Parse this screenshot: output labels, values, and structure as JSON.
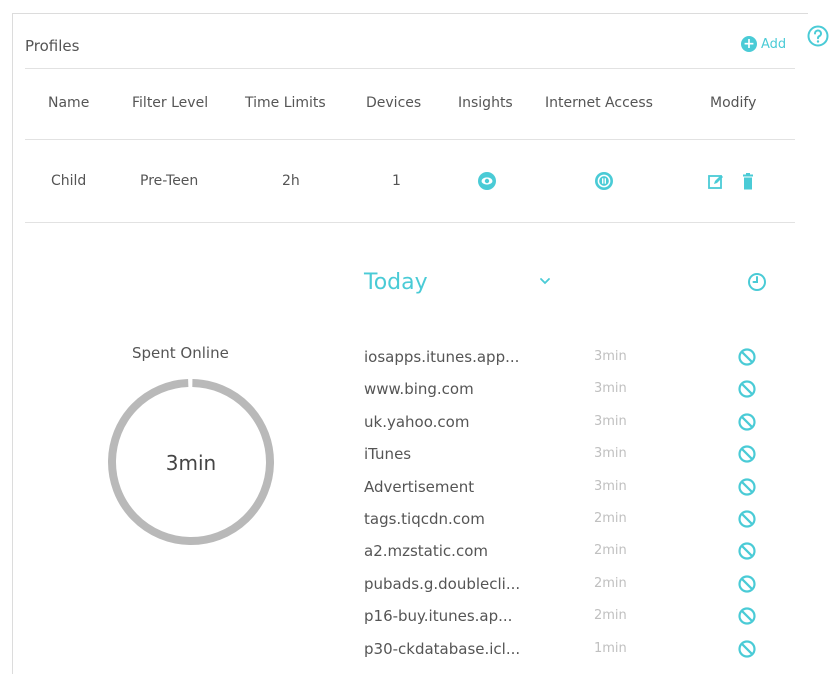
{
  "profiles": {
    "title": "Profiles",
    "add_label": "Add",
    "columns": [
      "Name",
      "Filter Level",
      "Time Limits",
      "Devices",
      "Insights",
      "Internet Access",
      "Modify"
    ],
    "rows": [
      {
        "name": "Child",
        "filter_level": "Pre-Teen",
        "time_limit": "2h",
        "devices": "1"
      }
    ]
  },
  "insights": {
    "period": "Today",
    "spent_label": "Spent Online",
    "spent_value": "3min",
    "entries": [
      {
        "domain": "iosapps.itunes.app...",
        "duration": "3min"
      },
      {
        "domain": "www.bing.com",
        "duration": "3min"
      },
      {
        "domain": "uk.yahoo.com",
        "duration": "3min"
      },
      {
        "domain": "iTunes",
        "duration": "3min"
      },
      {
        "domain": "Advertisement",
        "duration": "3min"
      },
      {
        "domain": "tags.tiqcdn.com",
        "duration": "2min"
      },
      {
        "domain": "a2.mzstatic.com",
        "duration": "2min"
      },
      {
        "domain": "pubads.g.doublecli...",
        "duration": "2min"
      },
      {
        "domain": "p16-buy.itunes.ap...",
        "duration": "2min"
      },
      {
        "domain": "p30-ckdatabase.icl...",
        "duration": "1min"
      }
    ]
  },
  "icons": {
    "help": "help-icon",
    "add": "plus-circle-icon",
    "insights": "eye-icon",
    "internet_access": "pause-icon",
    "edit": "edit-icon",
    "delete": "trash-icon",
    "dropdown": "chevron-down-icon",
    "history": "clock-icon",
    "block": "block-icon"
  },
  "colors": {
    "accent": "#4acbd6",
    "text": "#555555",
    "muted": "#c0c0c0",
    "ring": "#b9b9b9"
  }
}
